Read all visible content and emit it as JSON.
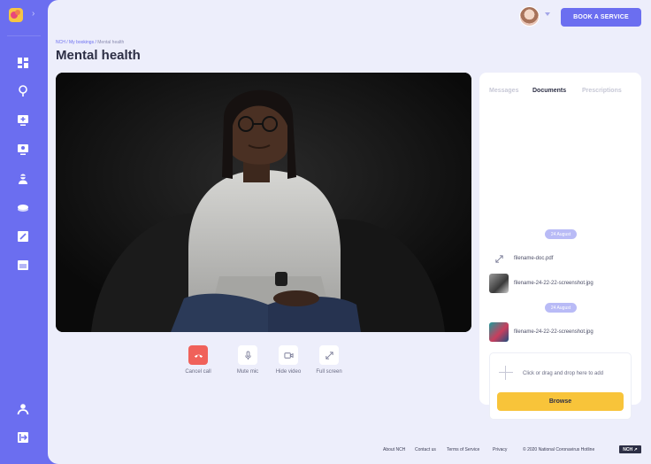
{
  "header": {
    "book_button": "BOOK A SERVICE"
  },
  "breadcrumb": {
    "items": [
      "NCH",
      "My bookings"
    ],
    "current": "Mental health"
  },
  "page": {
    "title": "Mental health"
  },
  "controls": [
    {
      "label": "Cancel call",
      "icon": "hang-up-icon"
    },
    {
      "label": "Mute mic",
      "icon": "microphone-icon"
    },
    {
      "label": "Hide video",
      "icon": "video-camera-icon"
    },
    {
      "label": "Full screen",
      "icon": "expand-icon"
    }
  ],
  "panel": {
    "tabs": [
      "Messages",
      "Documents",
      "Prescriptions"
    ],
    "active_tab": "Documents",
    "groups": [
      {
        "date": "24 August",
        "files": [
          {
            "name": "filename-doc.pdf",
            "type": "doc"
          },
          {
            "name": "filename-24-22-22-screenshot.jpg",
            "type": "image"
          }
        ]
      },
      {
        "date": "24 August",
        "files": [
          {
            "name": "filename-24-22-22-screenshot.jpg",
            "type": "image"
          }
        ]
      }
    ],
    "dropzone_text": "Click or drag and drop here to add",
    "browse_label": "Browse"
  },
  "footer": {
    "links": [
      "About NCH",
      "Contact us",
      "Terms of Service",
      "Privacy"
    ],
    "copyright": "© 2020 National Coronavirus Hotline",
    "badge": "NCH ↗"
  },
  "colors": {
    "accent": "#6b6ef0",
    "cancel": "#f0615a",
    "browse": "#f8c43a",
    "background": "#edeefb"
  }
}
